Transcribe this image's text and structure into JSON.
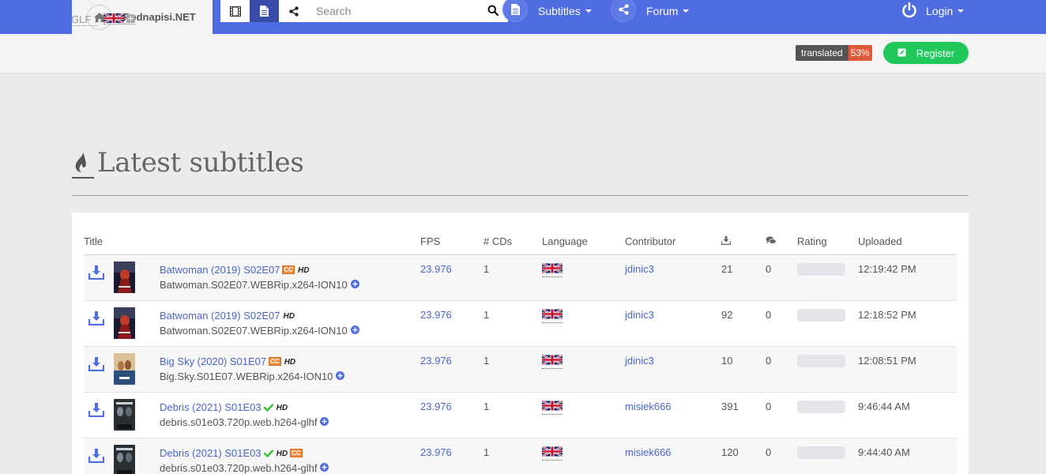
{
  "nav": {
    "brand": "Podnapisi.NET",
    "search_placeholder": "Search",
    "subtitles": "Subtitles",
    "forum": "Forum",
    "login": "Login"
  },
  "subbar": {
    "glf_label": "GLF :",
    "translated_label": "translated",
    "translated_percent": "53%",
    "register": "Register"
  },
  "heading": {
    "title": "Latest subtitles"
  },
  "table": {
    "headers": {
      "title": "Title",
      "fps": "FPS",
      "cds": "# CDs",
      "language": "Language",
      "contributor": "Contributor",
      "rating": "Rating",
      "uploaded": "Uploaded"
    },
    "rows": [
      {
        "title": "Batwoman (2019) S02E07",
        "release": "Batwoman.S02E07.WEBRip.x264-ION10",
        "fps": "23.976",
        "cds": "1",
        "contributor": "jdinic3",
        "downloads": "21",
        "comments": "0",
        "uploaded": "12:19:42 PM",
        "cc": true,
        "verified": false,
        "cc_after_hd": false,
        "poster": "batwoman"
      },
      {
        "title": "Batwoman (2019) S02E07",
        "release": "Batwoman.S02E07.WEBRip.x264-ION10",
        "fps": "23.976",
        "cds": "1",
        "contributor": "jdinic3",
        "downloads": "92",
        "comments": "0",
        "uploaded": "12:18:52 PM",
        "cc": false,
        "verified": false,
        "cc_after_hd": false,
        "poster": "batwoman"
      },
      {
        "title": "Big Sky (2020) S01E07",
        "release": "Big.Sky.S01E07.WEBRip.x264-ION10",
        "fps": "23.976",
        "cds": "1",
        "contributor": "jdinic3",
        "downloads": "10",
        "comments": "0",
        "uploaded": "12:08:51 PM",
        "cc": true,
        "verified": false,
        "cc_after_hd": false,
        "poster": "bigsky"
      },
      {
        "title": "Debris (2021) S01E03",
        "release": "debris.s01e03.720p.web.h264-glhf",
        "fps": "23.976",
        "cds": "1",
        "contributor": "misiek666",
        "downloads": "391",
        "comments": "0",
        "uploaded": "9:46:44 AM",
        "cc": false,
        "verified": true,
        "cc_after_hd": false,
        "poster": "debris"
      },
      {
        "title": "Debris (2021) S01E03",
        "release": "debris.s01e03.720p.web.h264-glhf",
        "fps": "23.976",
        "cds": "1",
        "contributor": "misiek666",
        "downloads": "120",
        "comments": "0",
        "uploaded": "9:44:40 AM",
        "cc": false,
        "verified": true,
        "cc_after_hd": true,
        "poster": "debris"
      }
    ]
  },
  "badges": {
    "cc": "CC",
    "hd": "HD"
  },
  "colors": {
    "navbar": "#4f6ce0",
    "accent_link": "#4966c9",
    "register": "#20c85a",
    "translated_pct": "#e05a3a"
  }
}
